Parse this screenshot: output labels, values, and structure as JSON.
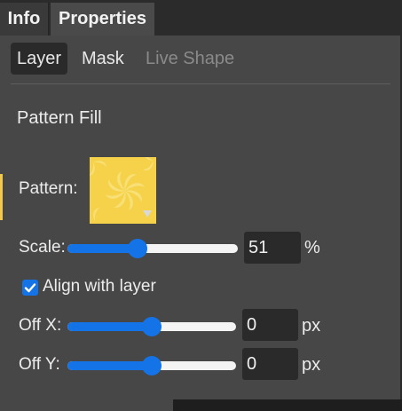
{
  "tabs": {
    "info": "Info",
    "properties": "Properties"
  },
  "subtabs": {
    "layer": "Layer",
    "mask": "Mask",
    "live_shape": "Live Shape"
  },
  "section_title": "Pattern Fill",
  "pattern": {
    "label": "Pattern:",
    "swatch_color": "#f5d24a",
    "swirl_color": "#f9e27c"
  },
  "scale": {
    "label": "Scale:",
    "value": "51",
    "unit": "%",
    "fraction": 0.41
  },
  "align": {
    "label": "Align with layer",
    "checked": true
  },
  "offset_x": {
    "label": "Off X:",
    "value": "0",
    "unit": "px",
    "fraction": 0.5
  },
  "offset_y": {
    "label": "Off Y:",
    "value": "0",
    "unit": "px",
    "fraction": 0.5
  },
  "colors": {
    "accent": "#1473e6",
    "panel_bg": "#474747",
    "tabbar_bg": "#2b2b2b"
  }
}
